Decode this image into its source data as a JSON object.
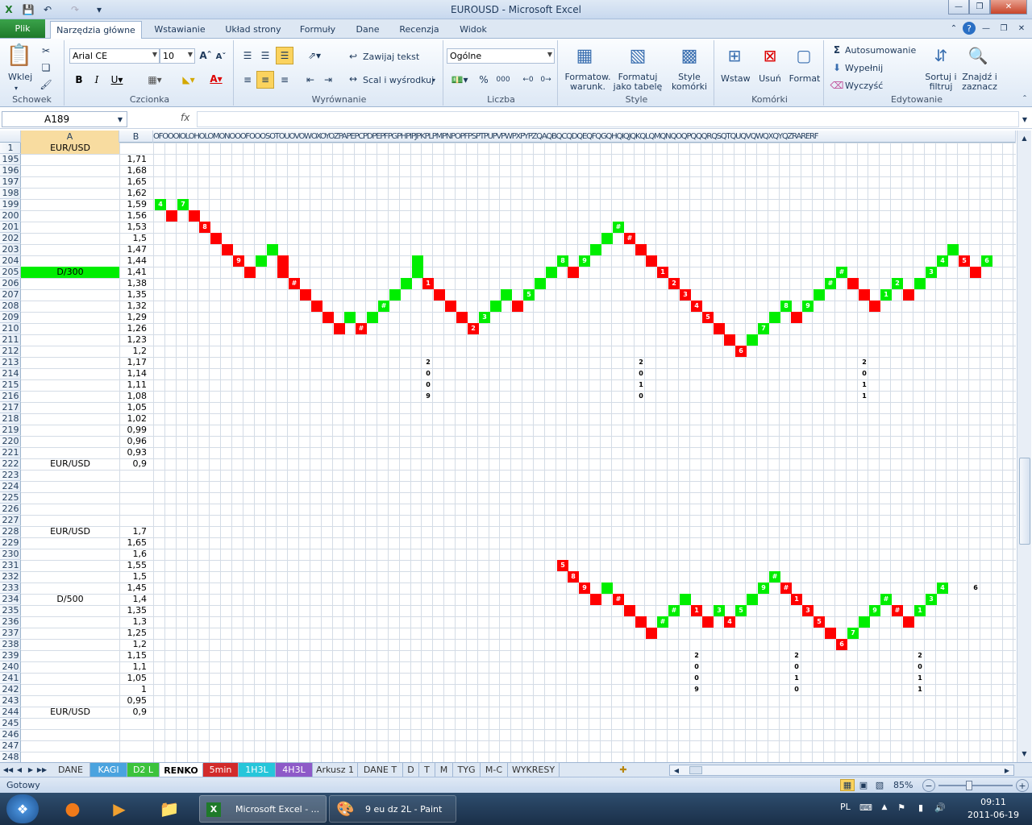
{
  "window": {
    "title": "EUROUSD  -  Microsoft Excel"
  },
  "ribbon_tabs": [
    {
      "label": "Plik"
    },
    {
      "label": "Narzędzia główne"
    },
    {
      "label": "Wstawianie"
    },
    {
      "label": "Układ strony"
    },
    {
      "label": "Formuły"
    },
    {
      "label": "Dane"
    },
    {
      "label": "Recenzja"
    },
    {
      "label": "Widok"
    }
  ],
  "ribbon": {
    "clipboard": {
      "paste": "Wklej",
      "group": "Schowek"
    },
    "font": {
      "name": "Arial CE",
      "size": "10",
      "group": "Czcionka"
    },
    "alignment": {
      "wrap": "Zawijaj tekst",
      "merge": "Scal i wyśrodkuj",
      "group": "Wyrównanie"
    },
    "number": {
      "format": "Ogólne",
      "group": "Liczba"
    },
    "styles": {
      "cond": "Formatow. warunk.",
      "table": "Formatuj jako tabelę",
      "cell": "Style komórki",
      "group": "Style"
    },
    "cells": {
      "insert": "Wstaw",
      "delete": "Usuń",
      "format": "Format",
      "group": "Komórki"
    },
    "editing": {
      "autosum": "Autosumowanie",
      "fill": "Wypełnij",
      "clear": "Wyczyść",
      "sort": "Sortuj i filtruj",
      "find": "Znajdź i zaznacz",
      "group": "Edytowanie"
    }
  },
  "namebox": "A189",
  "fx": "fx",
  "columns": {
    "a": "A",
    "b": "B",
    "rest": "OFOOOIOLOHOLOMONOOOFOOOSOTOUOVOWOXOYOZPAPEPCPDPEPFPGPHPIPJPKPLPMPNPOPFPSPTPUPVPWPXPYPZQAQBQCQDQEQFQGQHQIQJQKQLQMQNQOQPQQQRQSQTQUQVQWQXQYQZRARERF"
  },
  "rows": [
    {
      "n": "1",
      "a": "EUR/USD",
      "b": ""
    },
    {
      "n": "195",
      "a": "",
      "b": "1,71"
    },
    {
      "n": "196",
      "a": "",
      "b": "1,68"
    },
    {
      "n": "197",
      "a": "",
      "b": "1,65"
    },
    {
      "n": "198",
      "a": "",
      "b": "1,62"
    },
    {
      "n": "199",
      "a": "",
      "b": "1,59"
    },
    {
      "n": "200",
      "a": "",
      "b": "1,56"
    },
    {
      "n": "201",
      "a": "",
      "b": "1,53"
    },
    {
      "n": "202",
      "a": "",
      "b": "1,5"
    },
    {
      "n": "203",
      "a": "",
      "b": "1,47"
    },
    {
      "n": "204",
      "a": "",
      "b": "1,44"
    },
    {
      "n": "205",
      "a": "D/300",
      "b": "1,41"
    },
    {
      "n": "206",
      "a": "",
      "b": "1,38"
    },
    {
      "n": "207",
      "a": "",
      "b": "1,35"
    },
    {
      "n": "208",
      "a": "",
      "b": "1,32"
    },
    {
      "n": "209",
      "a": "",
      "b": "1,29"
    },
    {
      "n": "210",
      "a": "",
      "b": "1,26"
    },
    {
      "n": "211",
      "a": "",
      "b": "1,23"
    },
    {
      "n": "212",
      "a": "",
      "b": "1,2"
    },
    {
      "n": "213",
      "a": "",
      "b": "1,17"
    },
    {
      "n": "214",
      "a": "",
      "b": "1,14"
    },
    {
      "n": "215",
      "a": "",
      "b": "1,11"
    },
    {
      "n": "216",
      "a": "",
      "b": "1,08"
    },
    {
      "n": "217",
      "a": "",
      "b": "1,05"
    },
    {
      "n": "218",
      "a": "",
      "b": "1,02"
    },
    {
      "n": "219",
      "a": "",
      "b": "0,99"
    },
    {
      "n": "220",
      "a": "",
      "b": "0,96"
    },
    {
      "n": "221",
      "a": "",
      "b": "0,93"
    },
    {
      "n": "222",
      "a": "EUR/USD",
      "b": "0,9"
    },
    {
      "n": "223",
      "a": "",
      "b": ""
    },
    {
      "n": "224",
      "a": "",
      "b": ""
    },
    {
      "n": "225",
      "a": "",
      "b": ""
    },
    {
      "n": "226",
      "a": "",
      "b": ""
    },
    {
      "n": "227",
      "a": "",
      "b": ""
    },
    {
      "n": "228",
      "a": "EUR/USD",
      "b": "1,7"
    },
    {
      "n": "229",
      "a": "",
      "b": "1,65"
    },
    {
      "n": "230",
      "a": "",
      "b": "1,6"
    },
    {
      "n": "231",
      "a": "",
      "b": "1,55"
    },
    {
      "n": "232",
      "a": "",
      "b": "1,5"
    },
    {
      "n": "233",
      "a": "",
      "b": "1,45"
    },
    {
      "n": "234",
      "a": "D/500",
      "b": "1,4"
    },
    {
      "n": "235",
      "a": "",
      "b": "1,35"
    },
    {
      "n": "236",
      "a": "",
      "b": "1,3"
    },
    {
      "n": "237",
      "a": "",
      "b": "1,25"
    },
    {
      "n": "238",
      "a": "",
      "b": "1,2"
    },
    {
      "n": "239",
      "a": "",
      "b": "1,15"
    },
    {
      "n": "240",
      "a": "",
      "b": "1,1"
    },
    {
      "n": "241",
      "a": "",
      "b": "1,05"
    },
    {
      "n": "242",
      "a": "",
      "b": "1"
    },
    {
      "n": "243",
      "a": "",
      "b": "0,95"
    },
    {
      "n": "244",
      "a": "EUR/USD",
      "b": "0,9"
    },
    {
      "n": "245",
      "a": "",
      "b": ""
    },
    {
      "n": "246",
      "a": "",
      "b": ""
    },
    {
      "n": "247",
      "a": "",
      "b": ""
    },
    {
      "n": "248",
      "a": "",
      "b": ""
    }
  ],
  "highlight_color": "#00ee00",
  "renko_up_color": "#00ee00",
  "renko_down_color": "#ff0000",
  "renko1": [
    {
      "c": 0,
      "r": 199,
      "k": "g",
      "t": "4"
    },
    {
      "c": 1,
      "r": 200,
      "k": "r",
      "t": ""
    },
    {
      "c": 2,
      "r": 199,
      "k": "g",
      "t": "7"
    },
    {
      "c": 3,
      "r": 200,
      "k": "r",
      "t": ""
    },
    {
      "c": 4,
      "r": 201,
      "k": "r",
      "t": "8"
    },
    {
      "c": 5,
      "r": 202,
      "k": "r",
      "t": ""
    },
    {
      "c": 6,
      "r": 203,
      "k": "r",
      "t": ""
    },
    {
      "c": 7,
      "r": 204,
      "k": "r",
      "t": "9"
    },
    {
      "c": 8,
      "r": 205,
      "k": "r",
      "t": ""
    },
    {
      "c": 9,
      "r": 204,
      "k": "g",
      "t": ""
    },
    {
      "c": 10,
      "r": 203,
      "k": "g",
      "t": ""
    },
    {
      "c": 11,
      "r": 204,
      "k": "r",
      "t": ""
    },
    {
      "c": 11,
      "r": 205,
      "k": "r",
      "t": ""
    },
    {
      "c": 12,
      "r": 206,
      "k": "r",
      "t": "#"
    },
    {
      "c": 13,
      "r": 207,
      "k": "r",
      "t": ""
    },
    {
      "c": 14,
      "r": 208,
      "k": "r",
      "t": ""
    },
    {
      "c": 15,
      "r": 209,
      "k": "r",
      "t": ""
    },
    {
      "c": 16,
      "r": 210,
      "k": "r",
      "t": ""
    },
    {
      "c": 17,
      "r": 209,
      "k": "g",
      "t": ""
    },
    {
      "c": 18,
      "r": 210,
      "k": "r",
      "t": "#"
    },
    {
      "c": 19,
      "r": 209,
      "k": "g",
      "t": ""
    },
    {
      "c": 20,
      "r": 208,
      "k": "g",
      "t": "#"
    },
    {
      "c": 21,
      "r": 207,
      "k": "g",
      "t": ""
    },
    {
      "c": 22,
      "r": 206,
      "k": "g",
      "t": ""
    },
    {
      "c": 23,
      "r": 205,
      "k": "g",
      "t": ""
    },
    {
      "c": 23,
      "r": 204,
      "k": "g",
      "t": ""
    },
    {
      "c": 24,
      "r": 206,
      "k": "r",
      "t": "1"
    },
    {
      "c": 25,
      "r": 207,
      "k": "r",
      "t": ""
    },
    {
      "c": 26,
      "r": 208,
      "k": "r",
      "t": ""
    },
    {
      "c": 27,
      "r": 209,
      "k": "r",
      "t": ""
    },
    {
      "c": 28,
      "r": 210,
      "k": "r",
      "t": "2"
    },
    {
      "c": 29,
      "r": 209,
      "k": "g",
      "t": "3"
    },
    {
      "c": 30,
      "r": 208,
      "k": "g",
      "t": ""
    },
    {
      "c": 31,
      "r": 207,
      "k": "g",
      "t": ""
    },
    {
      "c": 32,
      "r": 208,
      "k": "r",
      "t": ""
    },
    {
      "c": 33,
      "r": 207,
      "k": "g",
      "t": "5"
    },
    {
      "c": 34,
      "r": 206,
      "k": "g",
      "t": ""
    },
    {
      "c": 35,
      "r": 205,
      "k": "g",
      "t": ""
    },
    {
      "c": 36,
      "r": 204,
      "k": "g",
      "t": "8"
    },
    {
      "c": 37,
      "r": 205,
      "k": "r",
      "t": ""
    },
    {
      "c": 38,
      "r": 204,
      "k": "g",
      "t": "9"
    },
    {
      "c": 39,
      "r": 203,
      "k": "g",
      "t": ""
    },
    {
      "c": 40,
      "r": 202,
      "k": "g",
      "t": ""
    },
    {
      "c": 41,
      "r": 201,
      "k": "g",
      "t": "#"
    },
    {
      "c": 42,
      "r": 202,
      "k": "r",
      "t": "#"
    },
    {
      "c": 43,
      "r": 203,
      "k": "r",
      "t": ""
    },
    {
      "c": 44,
      "r": 204,
      "k": "r",
      "t": ""
    },
    {
      "c": 45,
      "r": 205,
      "k": "r",
      "t": "1"
    },
    {
      "c": 46,
      "r": 206,
      "k": "r",
      "t": "2"
    },
    {
      "c": 47,
      "r": 207,
      "k": "r",
      "t": "3"
    },
    {
      "c": 48,
      "r": 208,
      "k": "r",
      "t": "4"
    },
    {
      "c": 49,
      "r": 209,
      "k": "r",
      "t": "5"
    },
    {
      "c": 50,
      "r": 210,
      "k": "r",
      "t": ""
    },
    {
      "c": 51,
      "r": 211,
      "k": "r",
      "t": ""
    },
    {
      "c": 52,
      "r": 212,
      "k": "r",
      "t": "6"
    },
    {
      "c": 53,
      "r": 211,
      "k": "g",
      "t": ""
    },
    {
      "c": 54,
      "r": 210,
      "k": "g",
      "t": "7"
    },
    {
      "c": 55,
      "r": 209,
      "k": "g",
      "t": ""
    },
    {
      "c": 56,
      "r": 208,
      "k": "g",
      "t": "8"
    },
    {
      "c": 57,
      "r": 209,
      "k": "r",
      "t": ""
    },
    {
      "c": 58,
      "r": 208,
      "k": "g",
      "t": "9"
    },
    {
      "c": 59,
      "r": 207,
      "k": "g",
      "t": ""
    },
    {
      "c": 60,
      "r": 206,
      "k": "g",
      "t": "#"
    },
    {
      "c": 61,
      "r": 205,
      "k": "g",
      "t": "#"
    },
    {
      "c": 62,
      "r": 206,
      "k": "r",
      "t": ""
    },
    {
      "c": 63,
      "r": 207,
      "k": "r",
      "t": ""
    },
    {
      "c": 64,
      "r": 208,
      "k": "r",
      "t": ""
    },
    {
      "c": 65,
      "r": 207,
      "k": "g",
      "t": "1"
    },
    {
      "c": 66,
      "r": 206,
      "k": "g",
      "t": "2"
    },
    {
      "c": 67,
      "r": 207,
      "k": "r",
      "t": ""
    },
    {
      "c": 68,
      "r": 206,
      "k": "g",
      "t": ""
    },
    {
      "c": 69,
      "r": 205,
      "k": "g",
      "t": "3"
    },
    {
      "c": 70,
      "r": 204,
      "k": "g",
      "t": "4"
    },
    {
      "c": 71,
      "r": 203,
      "k": "g",
      "t": ""
    },
    {
      "c": 72,
      "r": 204,
      "k": "r",
      "t": "5"
    },
    {
      "c": 73,
      "r": 205,
      "k": "r",
      "t": ""
    },
    {
      "c": 74,
      "r": 204,
      "k": "g",
      "t": "6"
    }
  ],
  "labels1": [
    {
      "c": 24,
      "r": 213,
      "t": "2"
    },
    {
      "c": 24,
      "r": 214,
      "t": "0"
    },
    {
      "c": 24,
      "r": 215,
      "t": "0"
    },
    {
      "c": 24,
      "r": 216,
      "t": "9"
    },
    {
      "c": 43,
      "r": 213,
      "t": "2"
    },
    {
      "c": 43,
      "r": 214,
      "t": "0"
    },
    {
      "c": 43,
      "r": 215,
      "t": "1"
    },
    {
      "c": 43,
      "r": 216,
      "t": "0"
    },
    {
      "c": 63,
      "r": 213,
      "t": "2"
    },
    {
      "c": 63,
      "r": 214,
      "t": "0"
    },
    {
      "c": 63,
      "r": 215,
      "t": "1"
    },
    {
      "c": 63,
      "r": 216,
      "t": "1"
    }
  ],
  "renko2": [
    {
      "c": 36,
      "r": 231,
      "k": "r",
      "t": "5"
    },
    {
      "c": 37,
      "r": 232,
      "k": "r",
      "t": "8"
    },
    {
      "c": 38,
      "r": 233,
      "k": "r",
      "t": "9"
    },
    {
      "c": 39,
      "r": 234,
      "k": "r",
      "t": ""
    },
    {
      "c": 40,
      "r": 233,
      "k": "g",
      "t": ""
    },
    {
      "c": 41,
      "r": 234,
      "k": "r",
      "t": "#"
    },
    {
      "c": 42,
      "r": 235,
      "k": "r",
      "t": ""
    },
    {
      "c": 43,
      "r": 236,
      "k": "r",
      "t": ""
    },
    {
      "c": 44,
      "r": 237,
      "k": "r",
      "t": ""
    },
    {
      "c": 45,
      "r": 236,
      "k": "g",
      "t": "#"
    },
    {
      "c": 46,
      "r": 235,
      "k": "g",
      "t": "#"
    },
    {
      "c": 47,
      "r": 234,
      "k": "g",
      "t": ""
    },
    {
      "c": 48,
      "r": 235,
      "k": "r",
      "t": "1"
    },
    {
      "c": 49,
      "r": 236,
      "k": "r",
      "t": ""
    },
    {
      "c": 50,
      "r": 235,
      "k": "g",
      "t": "3"
    },
    {
      "c": 51,
      "r": 236,
      "k": "r",
      "t": "4"
    },
    {
      "c": 52,
      "r": 235,
      "k": "g",
      "t": "5"
    },
    {
      "c": 53,
      "r": 234,
      "k": "g",
      "t": ""
    },
    {
      "c": 54,
      "r": 233,
      "k": "g",
      "t": "9"
    },
    {
      "c": 55,
      "r": 232,
      "k": "g",
      "t": "#"
    },
    {
      "c": 56,
      "r": 233,
      "k": "r",
      "t": "#"
    },
    {
      "c": 57,
      "r": 234,
      "k": "r",
      "t": "1"
    },
    {
      "c": 58,
      "r": 235,
      "k": "r",
      "t": "3"
    },
    {
      "c": 59,
      "r": 236,
      "k": "r",
      "t": "5"
    },
    {
      "c": 60,
      "r": 237,
      "k": "r",
      "t": ""
    },
    {
      "c": 61,
      "r": 238,
      "k": "r",
      "t": "6"
    },
    {
      "c": 62,
      "r": 237,
      "k": "g",
      "t": "7"
    },
    {
      "c": 63,
      "r": 236,
      "k": "g",
      "t": ""
    },
    {
      "c": 64,
      "r": 235,
      "k": "g",
      "t": "9"
    },
    {
      "c": 65,
      "r": 234,
      "k": "g",
      "t": "#"
    },
    {
      "c": 66,
      "r": 235,
      "k": "r",
      "t": "#"
    },
    {
      "c": 67,
      "r": 236,
      "k": "r",
      "t": ""
    },
    {
      "c": 68,
      "r": 235,
      "k": "g",
      "t": "1"
    },
    {
      "c": 69,
      "r": 234,
      "k": "g",
      "t": "3"
    },
    {
      "c": 70,
      "r": 233,
      "k": "g",
      "t": "4"
    }
  ],
  "labels2": [
    {
      "c": 73,
      "r": 233,
      "t": "6"
    },
    {
      "c": 48,
      "r": 239,
      "t": "2"
    },
    {
      "c": 48,
      "r": 240,
      "t": "0"
    },
    {
      "c": 48,
      "r": 241,
      "t": "0"
    },
    {
      "c": 48,
      "r": 242,
      "t": "9"
    },
    {
      "c": 57,
      "r": 239,
      "t": "2"
    },
    {
      "c": 57,
      "r": 240,
      "t": "0"
    },
    {
      "c": 57,
      "r": 241,
      "t": "1"
    },
    {
      "c": 57,
      "r": 242,
      "t": "0"
    },
    {
      "c": 68,
      "r": 239,
      "t": "2"
    },
    {
      "c": 68,
      "r": 240,
      "t": "0"
    },
    {
      "c": 68,
      "r": 241,
      "t": "1"
    },
    {
      "c": 68,
      "r": 242,
      "t": "1"
    }
  ],
  "sheets": [
    {
      "label": "DANE",
      "color": ""
    },
    {
      "label": "KAGI",
      "color": "#4aa3df"
    },
    {
      "label": "D2 L",
      "color": "#3cc33c"
    },
    {
      "label": "RENKO",
      "color": "#ffffff"
    },
    {
      "label": "5min",
      "color": "#d22b2b"
    },
    {
      "label": "1H3L",
      "color": "#26c6da"
    },
    {
      "label": "4H3L",
      "color": "#8e5ac8"
    },
    {
      "label": "Arkusz 1",
      "color": ""
    },
    {
      "label": "DANE T",
      "color": ""
    },
    {
      "label": "D",
      "color": ""
    },
    {
      "label": "T",
      "color": ""
    },
    {
      "label": "M",
      "color": ""
    },
    {
      "label": "TYG",
      "color": ""
    },
    {
      "label": "M-C",
      "color": ""
    },
    {
      "label": "WYKRESY",
      "color": ""
    }
  ],
  "status": {
    "ready": "Gotowy",
    "zoom": "85%"
  },
  "taskbar": {
    "excel": "Microsoft Excel - ...",
    "paint": "9 eu dz 2L - Paint",
    "lang": "PL",
    "time": "09:11",
    "date": "2011-06-19"
  }
}
